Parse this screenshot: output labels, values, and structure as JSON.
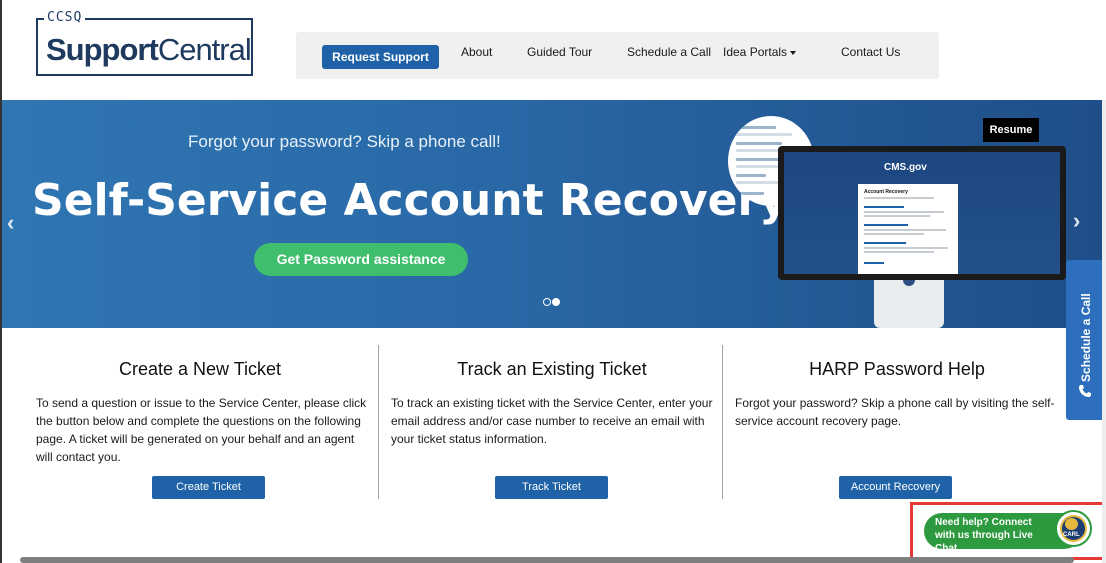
{
  "header": {
    "logo_prefix": "CCSQ",
    "logo_bold": "Support",
    "logo_light": "Central"
  },
  "nav": {
    "items": [
      {
        "label": "Request Support"
      },
      {
        "label": "About"
      },
      {
        "label": "Guided Tour"
      },
      {
        "label": "Schedule a Call"
      },
      {
        "label": "Idea Portals"
      },
      {
        "label": "Contact Us"
      }
    ]
  },
  "hero": {
    "tagline": "Forgot your password? Skip a phone call!",
    "title": "Self-Service Account Recovery",
    "button": "Get Password assistance",
    "resume": "Resume",
    "prev_arrow": "‹",
    "next_arrow": "›",
    "slides_total": 2,
    "slide_active": 2,
    "illustration": {
      "brand": "CMS.gov",
      "card_title": "Account Recovery"
    }
  },
  "columns": [
    {
      "title": "Create a New Ticket",
      "text": "To send a question or issue to the Service Center, please click the button below and complete the questions on the following page. A ticket will be generated on your behalf and an agent will contact you.",
      "button": "Create Ticket"
    },
    {
      "title": "Track an Existing Ticket",
      "text": "To track an existing ticket with the Service Center, enter your email address and/or case number to receive an email with your ticket status information.",
      "button": "Track Ticket"
    },
    {
      "title": "HARP Password Help",
      "text": "Forgot your password? Skip a phone call by visiting the self-service account recovery page.",
      "button": "Account Recovery"
    }
  ],
  "side_tab": {
    "label": "Schedule a Call",
    "icon": "phone-icon"
  },
  "chat": {
    "text": "Need help? Connect with us through Live Chat.",
    "avatar_label": "CARL"
  },
  "colors": {
    "brand_blue": "#1f62a8",
    "hero_blue": "#2968a6",
    "green": "#3fbf6e",
    "chat_green": "#2e9a3f",
    "highlight_red": "#e53935"
  }
}
